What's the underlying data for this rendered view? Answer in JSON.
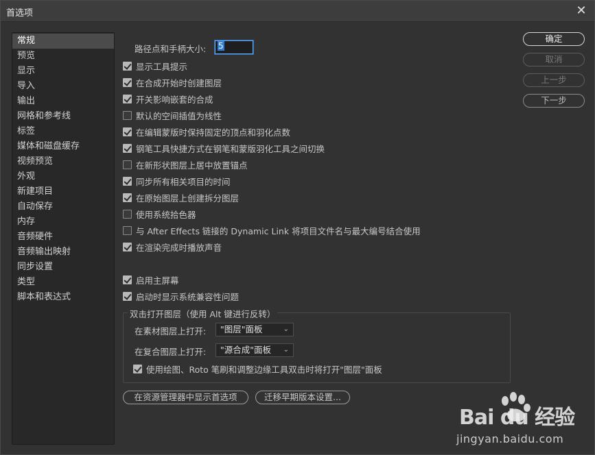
{
  "window": {
    "title": "首选项",
    "close_glyph": "✕"
  },
  "sidebar": {
    "items": [
      {
        "label": "常规",
        "selected": true
      },
      {
        "label": "预览"
      },
      {
        "label": "显示"
      },
      {
        "label": "导入"
      },
      {
        "label": "输出"
      },
      {
        "label": "网格和参考线"
      },
      {
        "label": "标签"
      },
      {
        "label": "媒体和磁盘缓存"
      },
      {
        "label": "视频预览"
      },
      {
        "label": "外观"
      },
      {
        "label": "新建项目"
      },
      {
        "label": "自动保存"
      },
      {
        "label": "内存"
      },
      {
        "label": "音频硬件"
      },
      {
        "label": "音频输出映射"
      },
      {
        "label": "同步设置"
      },
      {
        "label": "类型"
      },
      {
        "label": "脚本和表达式"
      }
    ]
  },
  "path_size": {
    "label": "路径点和手柄大小:",
    "value": "5"
  },
  "options": [
    {
      "label": "显示工具提示",
      "checked": true
    },
    {
      "label": "在合成开始时创建图层",
      "checked": true
    },
    {
      "label": "开关影响嵌套的合成",
      "checked": true
    },
    {
      "label": "默认的空间插值为线性",
      "checked": false
    },
    {
      "label": "在编辑蒙版时保持固定的顶点和羽化点数",
      "checked": true
    },
    {
      "label": "钢笔工具快捷方式在钢笔和蒙版羽化工具之间切换",
      "checked": true
    },
    {
      "label": "在新形状图层上居中放置锚点",
      "checked": false
    },
    {
      "label": "同步所有相关项目的时间",
      "checked": true
    },
    {
      "label": "在原始图层上创建拆分图层",
      "checked": true
    },
    {
      "label": "使用系统拾色器",
      "checked": false
    },
    {
      "label": "与 After Effects 链接的 Dynamic Link 将项目文件名与最大编号结合使用",
      "checked": false
    },
    {
      "label": "在渲染完成时播放声音",
      "checked": true
    },
    {
      "label": "启用主屏幕",
      "checked": true
    },
    {
      "label": "启动时显示系统兼容性问题",
      "checked": true
    }
  ],
  "double_click_group": {
    "legend": "双击打开图层（使用 Alt 键进行反转）",
    "footage_label": "在素材图层上打开:",
    "footage_value": "\"图层\"面板",
    "comp_label": "在复合图层上打开:",
    "comp_value": "\"源合成\"面板",
    "paint_option": {
      "label": "使用绘图、Roto 笔刷和调整边缘工具双击时将打开\"图层\"面板",
      "checked": true
    }
  },
  "buttons": {
    "ok": "确定",
    "cancel": "取消",
    "prev": "上一步",
    "next": "下一步",
    "reveal": "在资源管理器中显示首选项",
    "migrate": "迁移早期版本设置..."
  },
  "watermark": {
    "brand": "Bai du 经验",
    "url": "jingyan.baidu.com"
  },
  "colors": {
    "accent": "#2f7ed8",
    "bg": "#323232",
    "sidebar_bg": "#282828"
  }
}
